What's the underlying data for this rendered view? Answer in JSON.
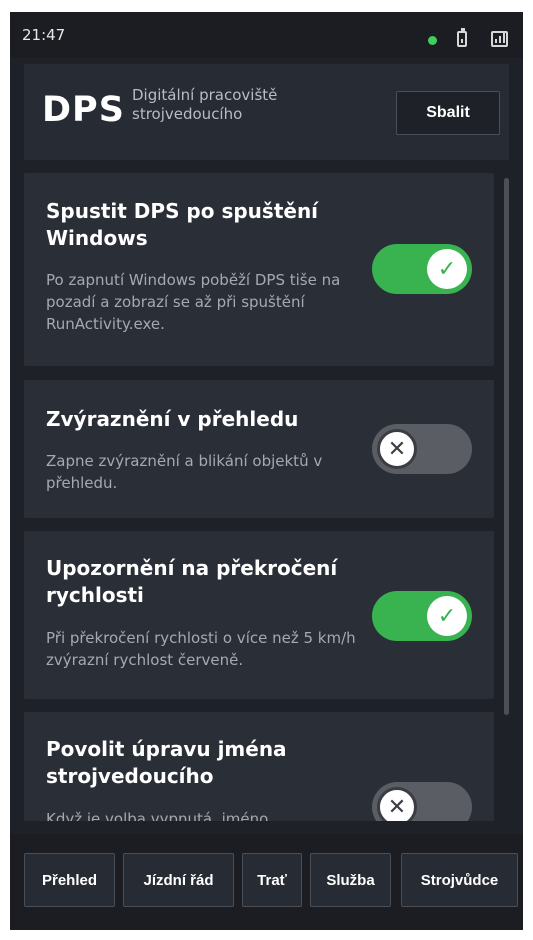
{
  "status_bar": {
    "time": "21:47",
    "dot_color": "#3fcf5f",
    "icons": [
      "status-dot-icon",
      "battery-icon",
      "signal-icon"
    ]
  },
  "header": {
    "logo": "DPS",
    "subtitle": "Digitální pracoviště strojvedoucího",
    "collapse_label": "Sbalit"
  },
  "settings": [
    {
      "title": "Spustit DPS po spuštění Windows",
      "description": "Po zapnutí Windows poběží DPS tiše na pozadí a zobrazí se až při spuštění RunActivity.exe.",
      "enabled": true
    },
    {
      "title": "Zvýraznění v přehledu",
      "description": "Zapne zvýraznění a blikání objektů v přehledu.",
      "enabled": false
    },
    {
      "title": "Upozornění na překročení rychlosti",
      "description": "Při překročení rychlosti o více než 5 km/h zvýrazní rychlost červeně.",
      "enabled": true
    },
    {
      "title": "Povolit úpravu jména strojvedoucího",
      "description": "Když je volba vypnutá, jméno",
      "enabled": false
    }
  ],
  "toggle_glyphs": {
    "on": "✓",
    "off": "✕"
  },
  "colors": {
    "toggle_on": "#38b34f",
    "toggle_off": "#5a5d63",
    "background": "#1e2128",
    "card": "#2a2e36"
  },
  "bottom_nav": [
    "Přehled",
    "Jízdní řád",
    "Trať",
    "Služba",
    "Strojvůdce"
  ]
}
